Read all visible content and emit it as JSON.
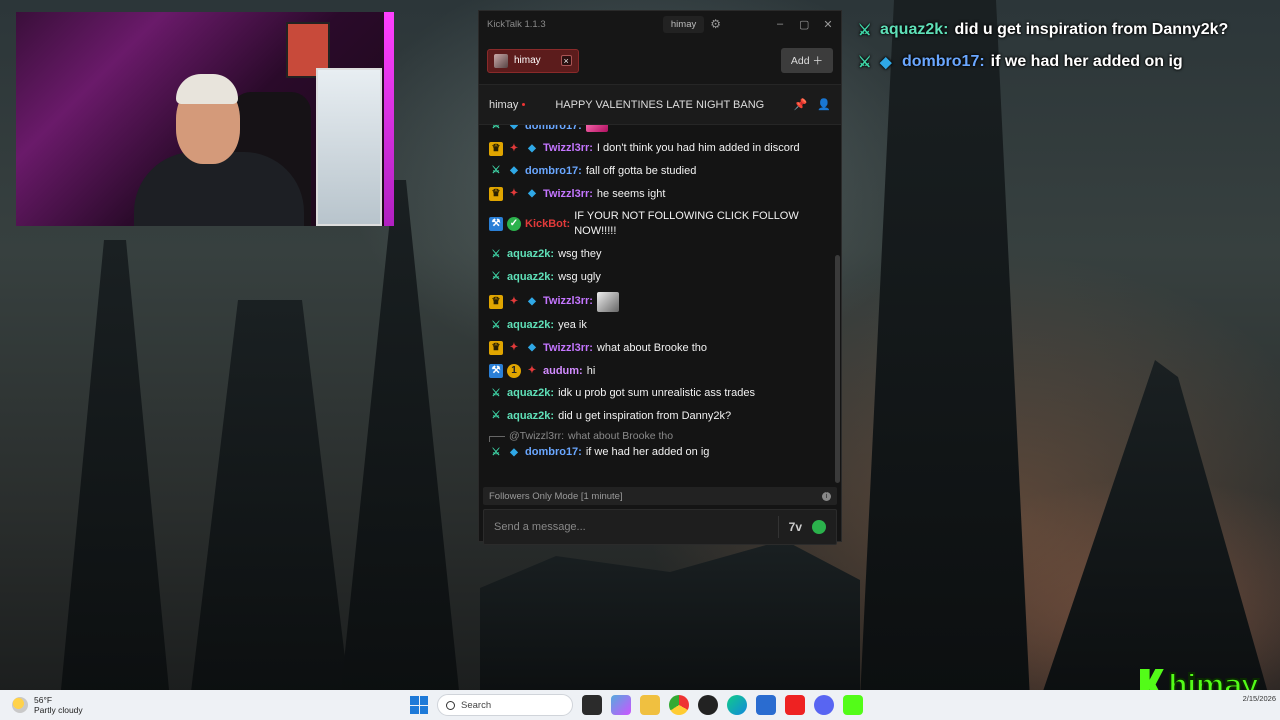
{
  "overlay_chat": [
    {
      "username": "aquaz2k:",
      "message": "did u get inspiration from Danny2k?",
      "badges": [
        "sword"
      ]
    },
    {
      "username": "dombro17:",
      "message": "if we had her added on ig",
      "badges": [
        "sword",
        "cube"
      ]
    }
  ],
  "kicktalk": {
    "window_title": "KickTalk 1.1.3",
    "current_user": "himay",
    "settings_icon": "gear-icon",
    "tabs": [
      {
        "label": "himay"
      }
    ],
    "add_label": "Add",
    "channel_name": "himay",
    "stream_title": "HAPPY VALENTINES LATE NIGHT BANG",
    "messages": [
      {
        "user": "dombro17:",
        "text": "",
        "badges": [
          "sword",
          "cube"
        ],
        "emote": true
      },
      {
        "user": "Twizzl3rr:",
        "text": "I don't think you had him added in discord",
        "badges": [
          "crown",
          "sub",
          "cube"
        ]
      },
      {
        "user": "dombro17:",
        "text": "fall off gotta be studied",
        "badges": [
          "sword",
          "cube"
        ]
      },
      {
        "user": "Twizzl3rr:",
        "text": "he seems ight",
        "badges": [
          "crown",
          "sub",
          "cube"
        ]
      },
      {
        "user": "KickBot:",
        "text": "IF YOUR NOT FOLLOWING CLICK FOLLOW NOW!!!!!",
        "badges": [
          "mod",
          "verified"
        ]
      },
      {
        "user": "aquaz2k:",
        "text": "wsg they",
        "badges": [
          "sword"
        ]
      },
      {
        "user": "aquaz2k:",
        "text": "wsg ugly",
        "badges": [
          "sword"
        ]
      },
      {
        "user": "Twizzl3rr:",
        "text": "",
        "badges": [
          "crown",
          "sub",
          "cube"
        ],
        "emote": true
      },
      {
        "user": "aquaz2k:",
        "text": "yea ik",
        "badges": [
          "sword"
        ]
      },
      {
        "user": "Twizzl3rr:",
        "text": "what about Brooke tho",
        "badges": [
          "crown",
          "sub",
          "cube"
        ]
      },
      {
        "user": "audum:",
        "text": "hi",
        "badges": [
          "mod",
          "one",
          "sub"
        ]
      },
      {
        "user": "aquaz2k:",
        "text": "idk u prob got sum unrealistic ass trades",
        "badges": [
          "sword"
        ]
      },
      {
        "user": "aquaz2k:",
        "text": "did u get inspiration from Danny2k?",
        "badges": [
          "sword"
        ]
      }
    ],
    "reply": {
      "to_user": "@Twizzl3rr:",
      "to_text": "what about Brooke tho"
    },
    "last_message": {
      "user": "dombro17:",
      "text": "if we had her added on ig",
      "badges": [
        "sword",
        "cube"
      ]
    },
    "mode_text": "Followers Only Mode [1 minute]",
    "input_placeholder": "Send a message..."
  },
  "watermark": {
    "text": "himay"
  },
  "taskbar": {
    "weather_temp": "56°F",
    "weather_desc": "Partly cloudy",
    "search_placeholder": "Search",
    "date": "2/15/2026"
  },
  "colors": {
    "kick_green": "#53fc18",
    "tab_red": "#5c1c1c",
    "aquaz_name": "#5fe0b8",
    "dombro_name": "#6aa7ff",
    "twizzl_name": "#c476ff",
    "kickbot_name": "#e23a3a"
  }
}
